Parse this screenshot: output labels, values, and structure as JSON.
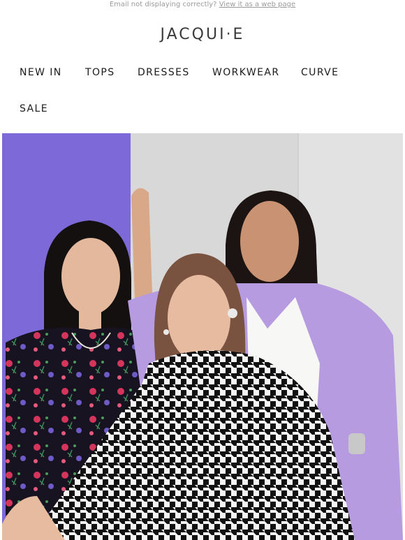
{
  "preheader": {
    "text": "Email not displaying correctly?",
    "link_label": "View it as a web page"
  },
  "brand": {
    "logo_text": "JACQUI·E"
  },
  "nav": {
    "items": [
      {
        "label": "NEW IN"
      },
      {
        "label": "TOPS"
      },
      {
        "label": "DRESSES"
      },
      {
        "label": "WORKWEAR"
      },
      {
        "label": "CURVE"
      },
      {
        "label": "SALE"
      }
    ]
  },
  "hero": {
    "colors": {
      "purple_panel": "#7d6ad8",
      "wall": "#dcdcdc",
      "lilac_blazer": "#b79be0",
      "white_top": "#f7f7f5"
    }
  }
}
